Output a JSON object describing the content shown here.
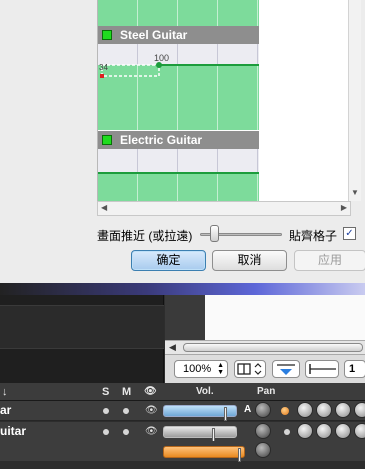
{
  "colors": {
    "track_green": "#7ddb9b",
    "swatch_green": "#1fdc1f",
    "header_grey": "#8e8e8e",
    "ok_blue": "#a8cbee",
    "vol_blue": "#6fa7d6",
    "master_orange": "#e98a21"
  },
  "dialog": {
    "tracks": [
      {
        "name": "Steel Guitar",
        "point_value": "100",
        "point_value_left": "34"
      },
      {
        "name": "Electric Guitar"
      }
    ],
    "zoom_label": "畫面推近 (或拉遠)",
    "zoom_level": 0.12,
    "snap_label": "貼齊格子",
    "snap_checked": "✓",
    "buttons": {
      "ok": "确定",
      "cancel": "取消",
      "apply": "应用"
    }
  },
  "daw": {
    "toolbar": {
      "zoom": "100%",
      "number": "1"
    },
    "header": {
      "name_arrow": "↓",
      "solo": "S",
      "mute": "M",
      "eye": "👁",
      "vol": "Vol.",
      "pan": "Pan"
    },
    "tracks": [
      {
        "name": "ar",
        "vol_level": 0.88,
        "auto": "A"
      },
      {
        "name": "uitar",
        "vol_level": 0.7
      }
    ],
    "master": {
      "vol_level": 0.98
    }
  }
}
